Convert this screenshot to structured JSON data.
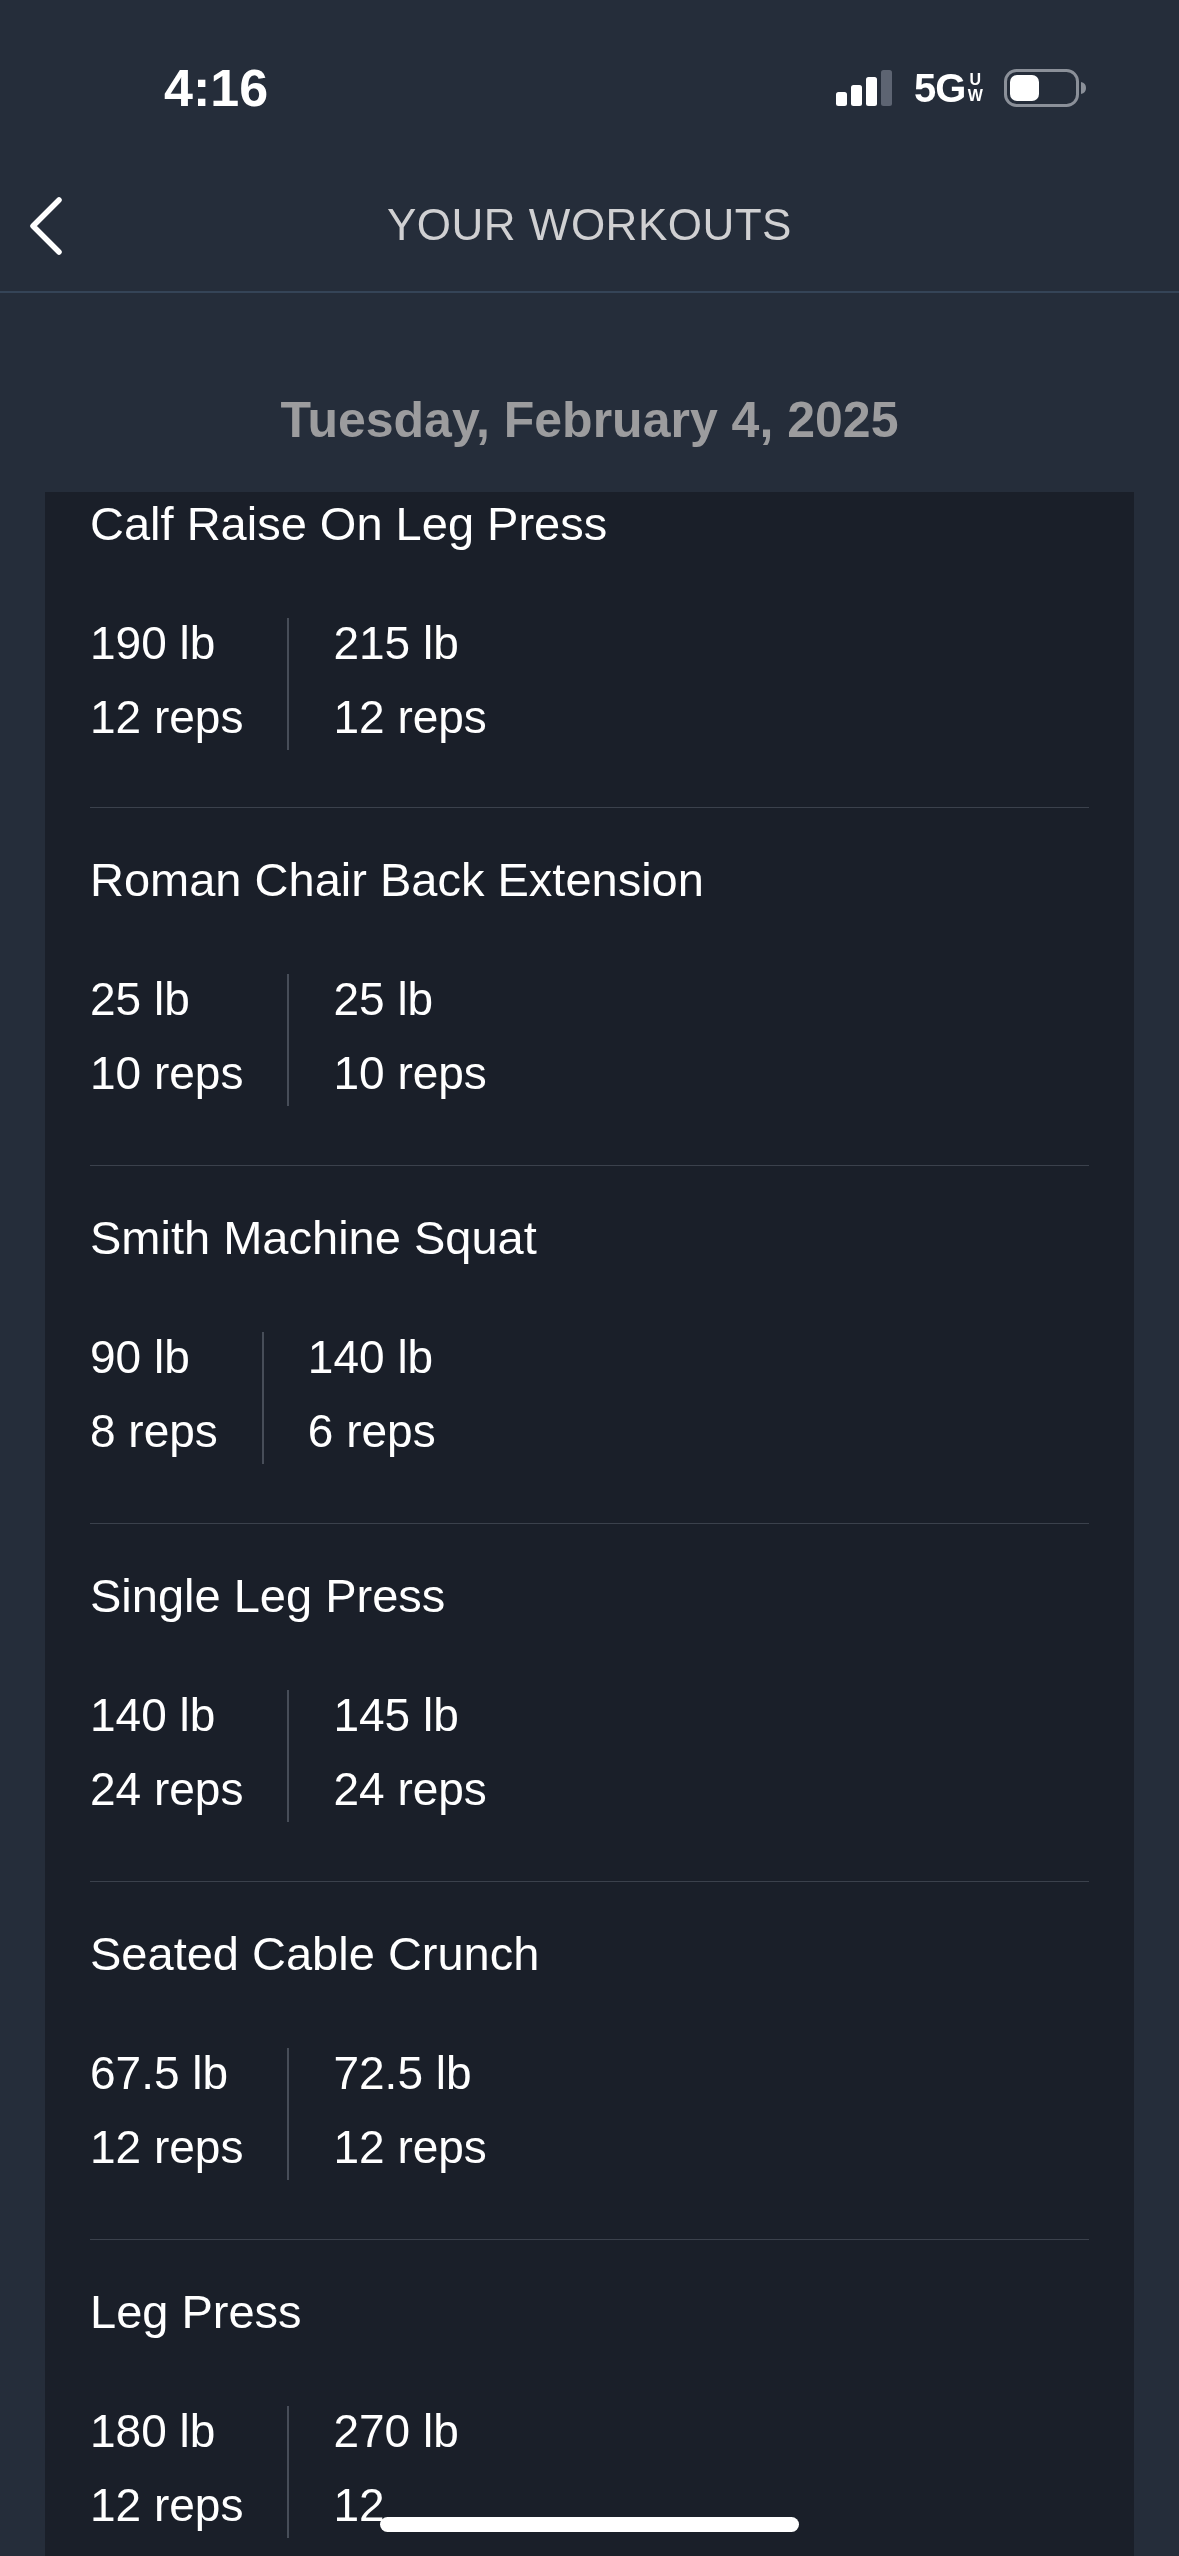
{
  "status_bar": {
    "time": "4:16",
    "network": "5G",
    "network_band": "UW"
  },
  "header": {
    "title": "YOUR WORKOUTS"
  },
  "date": "Tuesday, February 4, 2025",
  "exercises": [
    {
      "name": "Calf Raise On Leg Press",
      "sets": [
        {
          "weight": "190 lb",
          "reps": "12 reps"
        },
        {
          "weight": "215 lb",
          "reps": "12 reps"
        }
      ]
    },
    {
      "name": "Roman Chair Back Extension",
      "sets": [
        {
          "weight": "25 lb",
          "reps": "10 reps"
        },
        {
          "weight": "25 lb",
          "reps": "10 reps"
        }
      ]
    },
    {
      "name": "Smith Machine Squat",
      "sets": [
        {
          "weight": "90 lb",
          "reps": "8 reps"
        },
        {
          "weight": "140 lb",
          "reps": "6 reps"
        }
      ]
    },
    {
      "name": "Single Leg Press",
      "sets": [
        {
          "weight": "140 lb",
          "reps": "24 reps"
        },
        {
          "weight": "145 lb",
          "reps": "24 reps"
        }
      ]
    },
    {
      "name": "Seated Cable Crunch",
      "sets": [
        {
          "weight": "67.5 lb",
          "reps": "12 reps"
        },
        {
          "weight": "72.5 lb",
          "reps": "12 reps"
        }
      ]
    },
    {
      "name": "Leg Press",
      "sets": [
        {
          "weight": "180 lb",
          "reps": "12 reps"
        },
        {
          "weight": "270 lb",
          "reps": "12"
        }
      ]
    }
  ]
}
